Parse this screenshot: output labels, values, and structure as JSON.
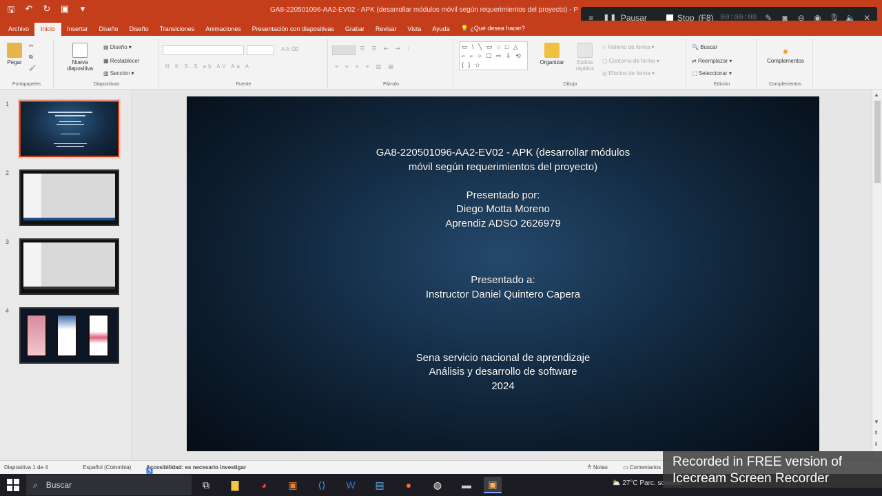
{
  "window": {
    "doc_title": "GA8-220501096-AA2-EV02 - APK (desarrollar módulos móvil según requerimientos del proyecto) - P"
  },
  "recorder": {
    "pause_label": "Pausar",
    "stop_label": "Stop",
    "stop_shortcut": "(F8)",
    "timer": "00:00:00"
  },
  "ribbon_tabs": [
    "Archivo",
    "Inicio",
    "Insertar",
    "Diseño",
    "Diseño",
    "Transiciones",
    "Animaciones",
    "Presentación con diapositivas",
    "Grabar",
    "Revisar",
    "Vista",
    "Ayuda"
  ],
  "tell_me": "¿Qué desea hacer?",
  "ribbon": {
    "paste": "Pegar",
    "clipboard_group": "Portapapeles",
    "new_slide_line1": "Nueva",
    "new_slide_line2": "diapositiva",
    "layout": "Diseño",
    "reset": "Restablecer",
    "section": "Sección",
    "slides_group": "Diapositivas",
    "font_group": "Fuente",
    "paragraph_group": "Párrafo",
    "arrange": "Organizar",
    "quick_styles_line1": "Estilos",
    "quick_styles_line2": "rápidos",
    "shape_fill": "Relleno de forma",
    "shape_outline": "Contorno de forma",
    "shape_effects": "Efectos de forma",
    "drawing_group": "Dibujo",
    "find": "Buscar",
    "replace": "Reemplazar",
    "select": "Seleccionar",
    "editing_group": "Edición",
    "addins": "Complementos",
    "addins_group": "Complementos",
    "font_format_row": "N K S S ab AV Aa A",
    "shape_glyphs": "▭ \\ ╲ ▭ ○ □ △ ⌐ ⌐ ○ ☐ ⇨ ⇩ ⟲ { } ☆"
  },
  "thumbnails": {
    "numbers": [
      "1",
      "2",
      "3",
      "4"
    ]
  },
  "slide": {
    "title_line1": "GA8-220501096-AA2-EV02 - APK (desarrollar módulos",
    "title_line2": "móvil según requerimientos del proyecto)",
    "presented_by": "Presentado por:",
    "author": "Diego Motta Moreno",
    "author_role": "Aprendiz ADSO 2626979",
    "presented_to": "Presentado a:",
    "instructor": "Instructor Daniel Quintero Capera",
    "institution": "Sena servicio nacional de aprendizaje",
    "program": "Análisis y desarrollo de software",
    "year": "2024"
  },
  "statusbar": {
    "slide_count": "Diapositiva 1 de 4",
    "language": "Español (Colombia)",
    "accessibility": "Accesibilidad: es necesario investigar",
    "notes": "Notas",
    "comments": "Comentarios"
  },
  "taskbar": {
    "search": "Buscar",
    "weather": "27°C  Parc. soleado"
  },
  "watermark": {
    "line1": "Recorded in FREE version of",
    "line2": "Icecream  Screen  Recorder"
  },
  "colors": {
    "accent": "#c43e1c",
    "slide_bg": "#16314b"
  }
}
